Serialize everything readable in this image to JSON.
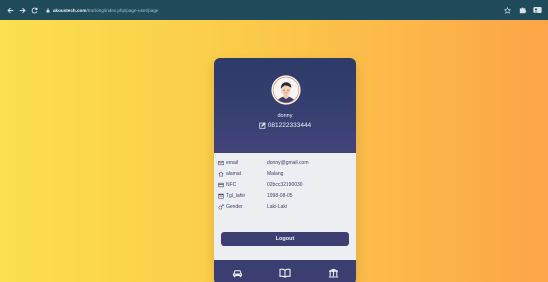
{
  "browser": {
    "url_domain": "akoustech.com",
    "url_path": "/tracking/index.php/page-user/page",
    "icons": {
      "back": "arrow-left-icon",
      "forward": "arrow-right-icon",
      "reload": "reload-icon",
      "lock": "lock-icon",
      "star": "star-icon",
      "extensions": "puzzle-icon",
      "profile": "profile-icon"
    }
  },
  "theme": {
    "page_gradient": [
      "#fbe04f",
      "#fbc94a",
      "#fca548"
    ],
    "card_header": "#2c3b68",
    "card_body": "#eceef2",
    "accent": "#3d3f72",
    "browser_bar": "#1f4b5b"
  },
  "profile": {
    "name": "donny",
    "phone": "081222333444",
    "avatar_icon": "user-avatar-icon",
    "edit_icon": "edit-icon"
  },
  "info": [
    {
      "icon": "mail-icon",
      "label": "email",
      "value": "donny@gmail.com"
    },
    {
      "icon": "home-icon",
      "label": "alamat",
      "value": "Malang"
    },
    {
      "icon": "card-icon",
      "label": "NFC",
      "value": "02bcc32190030"
    },
    {
      "icon": "calendar-icon",
      "label": "Tgl_lahir",
      "value": "1998-08-05"
    },
    {
      "icon": "gender-icon",
      "label": "Gender",
      "value": "Laki-Laki"
    }
  ],
  "actions": {
    "logout_label": "Logout"
  },
  "bottom_nav": [
    {
      "icon": "car-icon"
    },
    {
      "icon": "book-icon"
    },
    {
      "icon": "bank-icon"
    }
  ]
}
